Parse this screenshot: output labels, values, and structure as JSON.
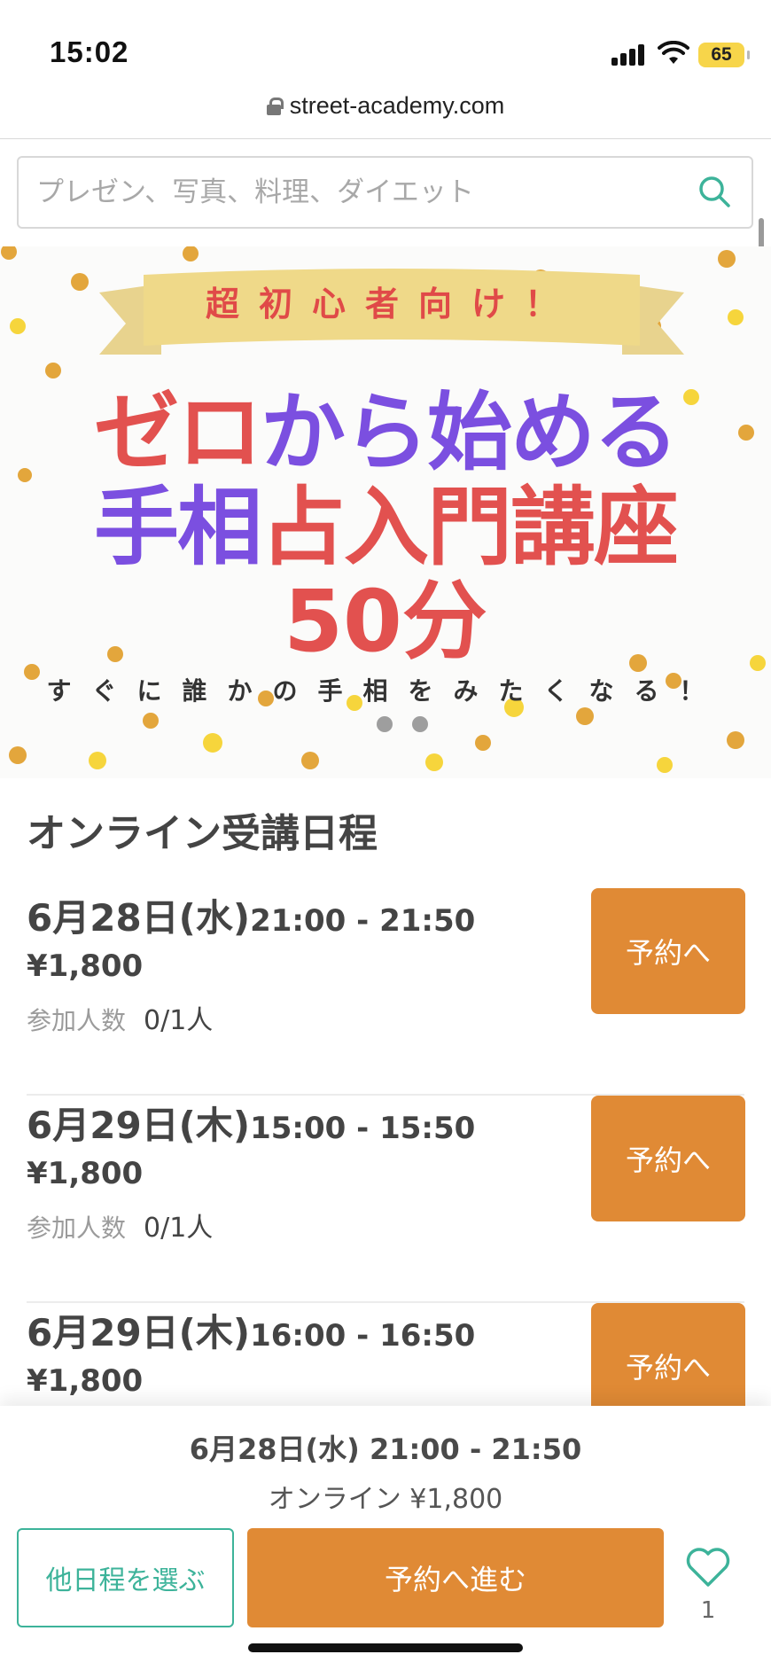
{
  "status_bar": {
    "time": "15:02",
    "battery": "65"
  },
  "browser": {
    "url": "street-academy.com"
  },
  "search": {
    "placeholder": "プレゼン、写真、料理、ダイエット"
  },
  "hero": {
    "ribbon": "超初心者向け！",
    "line1_red": "ゼロ",
    "line1_purple": "から始める",
    "line2_purple": "手相",
    "line2_red": "占入門講座",
    "line3": "50分",
    "sub": "すぐに誰かの手相をみたくなる！",
    "pages": 2
  },
  "schedule": {
    "title": "オンライン受講日程",
    "capacity_label": "参加人数",
    "reserve_label": "予約へ",
    "items": [
      {
        "date": "6月28日(水)",
        "time": "21:00 - 21:50",
        "price": "¥1,800",
        "capacity": "0/1人"
      },
      {
        "date": "6月29日(木)",
        "time": "15:00 - 15:50",
        "price": "¥1,800",
        "capacity": "0/1人"
      },
      {
        "date": "6月29日(木)",
        "time": "16:00 - 16:50",
        "price": "¥1,800"
      }
    ]
  },
  "bottom_bar": {
    "selected_date": "6月28日(水) 21:00 - 21:50",
    "selected_price": "オンライン ¥1,800",
    "other_dates_label": "他日程を選ぶ",
    "proceed_label": "予約へ進む",
    "favorite_count": "1"
  },
  "colors": {
    "accent_orange": "#e08a35",
    "accent_green": "#3db39a",
    "hero_red": "#e2514f",
    "hero_purple": "#7b4fe0"
  }
}
